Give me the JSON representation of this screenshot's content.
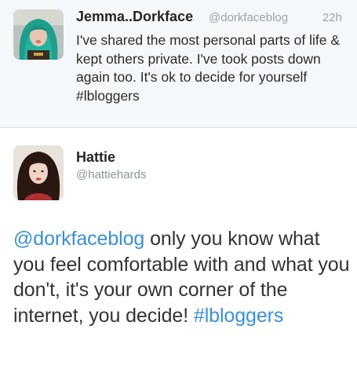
{
  "reply_tweet": {
    "author_name": "Jemma..Dorkface",
    "author_handle": "@dorkfaceblog",
    "timestamp": "22h",
    "text_before_tag": "I've shared the most personal parts of life & kept others private. I've took posts down again too. It's ok to decide for yourself ",
    "hashtag": "#lbloggers"
  },
  "main_tweet": {
    "author_name": "Hattie",
    "author_handle": "@hattiehards",
    "mention": "@dorkfaceblog",
    "text_body": " only you know what you feel comfortable with and what you don't, it's your own corner of the internet, you decide!",
    "hashtag": "#lbloggers"
  },
  "colors": {
    "link": "#3a8fd6",
    "reply_background": "#f5f8fa",
    "secondary_text": "#9ba3aa"
  }
}
